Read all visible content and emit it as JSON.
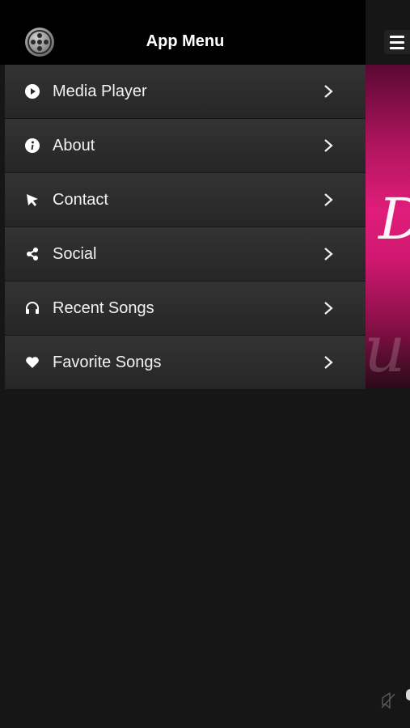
{
  "header": {
    "title": "App Menu",
    "logo_icon": "film-reel-icon"
  },
  "menu": {
    "items": [
      {
        "label": "Media Player",
        "icon": "play-circle-icon"
      },
      {
        "label": "About",
        "icon": "info-icon"
      },
      {
        "label": "Contact",
        "icon": "pointer-icon"
      },
      {
        "label": "Social",
        "icon": "share-icon"
      },
      {
        "label": "Recent Songs",
        "icon": "headphones-icon"
      },
      {
        "label": "Favorite Songs",
        "icon": "heart-icon"
      }
    ]
  },
  "colors": {
    "background": "#161616",
    "header": "#000000",
    "banner_accent": "#e01d7a"
  }
}
